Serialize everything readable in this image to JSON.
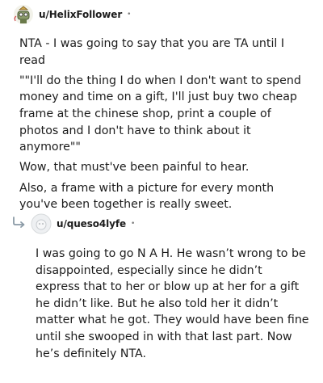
{
  "comments": [
    {
      "username": "u/HelixFollower",
      "separator": "•",
      "paragraphs": [
        "NTA - I was going to say that you are TA until I read",
        "\"\"I'll do the thing I do when I don't want to spend money and time on a gift, I'll just buy two cheap frame at the chinese shop, print a couple of photos and I don't have to think about it anymore\"\"",
        "Wow, that must've been painful to hear.",
        "Also, a frame with a picture for every month you've been together is really sweet."
      ]
    },
    {
      "username": "u/queso4lyfe",
      "separator": "•",
      "paragraphs": [
        "I was going to go N A H. He wasn’t wrong to be disappointed, especially since he didn’t express that to her or blow up at her for a gift he didn’t like. But he also told her it didn’t matter what he got. They would have been fine until she swooped in with that last part. Now he’s definitely NTA."
      ]
    }
  ]
}
